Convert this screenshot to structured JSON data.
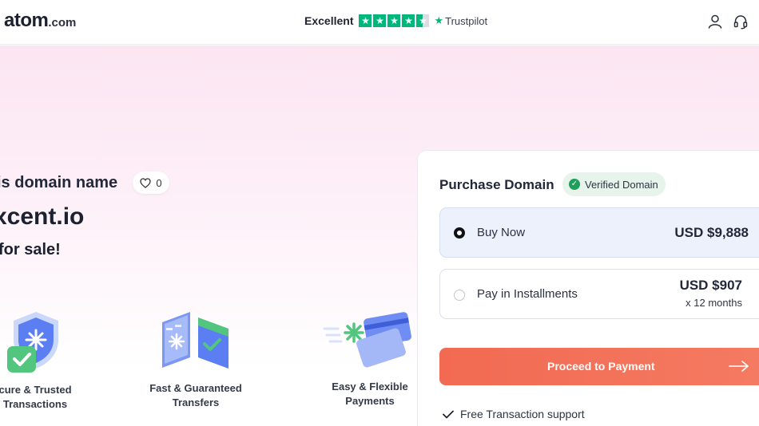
{
  "header": {
    "logo_main": "atom",
    "logo_suffix": ".com",
    "rating_label": "Excellent",
    "rating_stars": 4.5,
    "trustpilot_label": "Trustpilot",
    "icons": [
      "user-icon",
      "headset-icon"
    ]
  },
  "hero": {
    "headline": "is domain name",
    "likes": "0",
    "domain": "xcent.io",
    "for_sale": "for sale!",
    "features": [
      {
        "line1": "cure & Trusted",
        "line2": "Transactions",
        "icon": "shield-check-icon"
      },
      {
        "line1": "Fast & Guaranteed",
        "line2": "Transfers",
        "icon": "transfer-icon"
      },
      {
        "line1": "Easy & Flexible",
        "line2": "Payments",
        "icon": "cards-icon"
      }
    ]
  },
  "purchase": {
    "title": "Purchase Domain",
    "verified_label": "Verified Domain",
    "options": [
      {
        "label": "Buy Now",
        "price": "USD $9,888",
        "selected": true
      },
      {
        "label": "Pay in Installments",
        "price": "USD $907",
        "sub": "x 12 months",
        "selected": false
      }
    ],
    "proceed_label": "Proceed to Payment",
    "support_label": "Free Transaction support"
  },
  "colors": {
    "accent": "#f26a52",
    "trustpilot": "#00b67a",
    "verified": "#1e9e5a",
    "selected_bg": "#edf1fb"
  }
}
